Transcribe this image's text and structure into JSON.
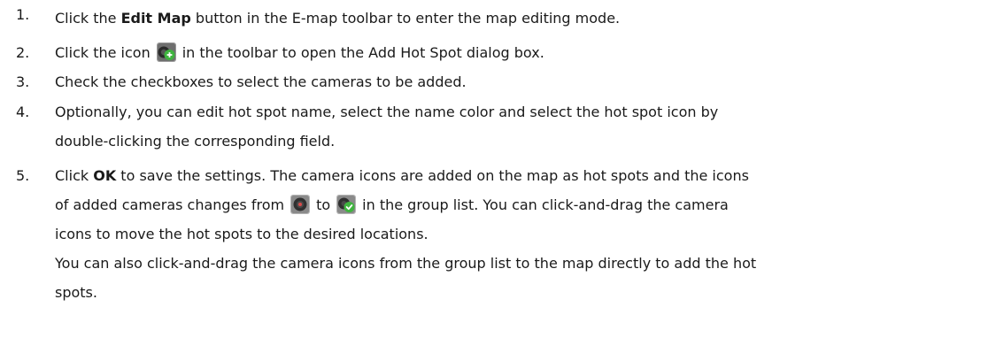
{
  "steps": [
    {
      "number": "1.",
      "before": "Click the ",
      "bold": "Edit Map",
      "after": " button in the E-map toolbar to enter the map editing mode."
    },
    {
      "number": "2.",
      "before": "Click the icon",
      "icon": "add-hot-spot-icon",
      "after": "in the toolbar to open the Add Hot Spot dialog box."
    },
    {
      "number": "3.",
      "text": "Check the checkboxes to select the cameras to be added."
    },
    {
      "number": "4.",
      "line1": "Optionally, you can edit hot spot name, select the name color and select the hot spot icon by",
      "line2": "double-clicking the corresponding field."
    },
    {
      "number": "5.",
      "before": "Click ",
      "bold": "OK",
      "line1_after": " to save the settings. The camera icons are added on the map as hot spots and the icons",
      "line2_before": "of added cameras changes from",
      "icon_from": "camera-icon",
      "line2_mid": "to",
      "icon_to": "camera-added-icon",
      "line2_after": "in the group list. You can click-and-drag the camera",
      "line3": "icons to move the hot spots to the desired locations."
    }
  ],
  "note": {
    "line1": "You can also click-and-drag the camera icons from the group list to the map directly to add the hot",
    "line2": "spots."
  },
  "colors": {
    "text": "#1a1a1a",
    "icon_green": "#3fb43f",
    "icon_dark": "#3a3a3a",
    "icon_red": "#d94a4a"
  }
}
